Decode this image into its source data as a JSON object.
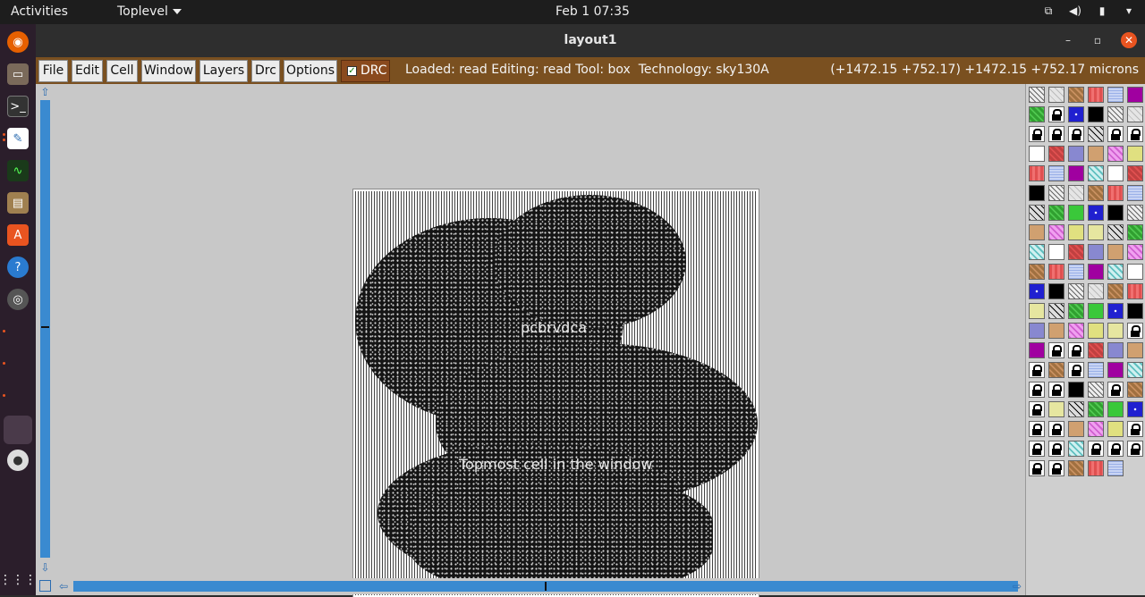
{
  "topbar": {
    "activities": "Activities",
    "app_menu": "Toplevel",
    "clock": "Feb 1  07:35"
  },
  "dock": {
    "items": [
      "firefox-icon",
      "files-icon",
      "terminal-icon",
      "text-editor-icon",
      "system-monitor-icon",
      "archive-icon",
      "software-center-icon",
      "help-icon",
      "settings-icon",
      "disc-icon",
      "show-apps-icon"
    ]
  },
  "window": {
    "title": "layout1"
  },
  "menubar": {
    "items": [
      "File",
      "Edit",
      "Cell",
      "Window",
      "Layers",
      "Drc",
      "Options"
    ],
    "drc_toggle": "DRC",
    "drc_checked": true,
    "status": "Loaded: read Editing: read Tool: box  Technology: sky130A",
    "coords": "(+1472.15 +752.17) +1472.15 +752.17 microns"
  },
  "canvas": {
    "cell_labels": [
      "pcbrvdca",
      "Topmost cell in the window"
    ]
  },
  "colors": {
    "menubar_bg": "#7a5020",
    "drc_bg": "#8a4a1e",
    "scroll_blue": "#3a8ad0",
    "canvas_bg": "#c8c8c8"
  }
}
